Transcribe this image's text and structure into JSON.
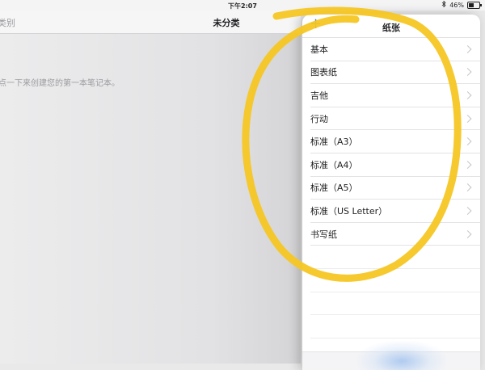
{
  "status_bar": {
    "time": "下午2:07",
    "bluetooth_icon": "bluetooth-icon",
    "battery_text": "46%",
    "battery_level": 0.46
  },
  "nav_bar": {
    "back_label": "类别",
    "title": "未分类"
  },
  "content": {
    "empty_hint": "点一下来创建您的第一本笔记本。"
  },
  "popover": {
    "add_icon": "plus-icon",
    "add_glyph": "+",
    "title": "纸张",
    "items": [
      {
        "label": "基本"
      },
      {
        "label": "图表纸"
      },
      {
        "label": "吉他"
      },
      {
        "label": "行动"
      },
      {
        "label": "标准（A3）"
      },
      {
        "label": "标准（A4）"
      },
      {
        "label": "标准（A5）"
      },
      {
        "label": "标准（US Letter）"
      },
      {
        "label": "书写纸"
      }
    ]
  },
  "colors": {
    "accent": "#2f7dd1",
    "annotation": "#f6c623"
  }
}
